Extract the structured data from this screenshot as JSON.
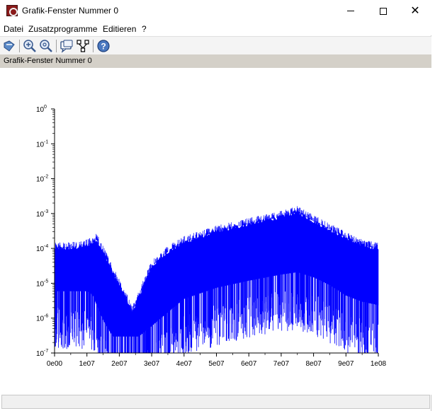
{
  "window": {
    "title": "Grafik-Fenster Nummer 0"
  },
  "menu": {
    "items": [
      "Datei",
      "Zusatzprogramme",
      "Editieren",
      "?"
    ]
  },
  "toolbar": {
    "tools": [
      "rotate-icon",
      "zoom-in-icon",
      "zoom-out-icon",
      "datatip-icon",
      "edit-tree-icon",
      "help-icon"
    ]
  },
  "info_bar": {
    "text": "Grafik-Fenster Nummer 0"
  },
  "colors": {
    "series": "#0000ff",
    "axis": "#000000"
  },
  "chart_data": {
    "type": "area",
    "xlabel": "",
    "ylabel": "",
    "xscale": "linear",
    "yscale": "log",
    "xlim": [
      0,
      100000000
    ],
    "ylim": [
      1e-07,
      1
    ],
    "x_ticks": [
      0,
      10000000,
      20000000,
      30000000,
      40000000,
      50000000,
      60000000,
      70000000,
      80000000,
      90000000,
      100000000
    ],
    "x_tick_labels": [
      "0e00",
      "1e07",
      "2e07",
      "3e07",
      "4e07",
      "5e07",
      "6e07",
      "7e07",
      "8e07",
      "9e07",
      "1e08"
    ],
    "y_ticks": [
      1,
      0.1,
      0.01,
      0.001,
      0.0001,
      1e-05,
      1e-06,
      1e-07
    ],
    "y_tick_bases": [
      "10",
      "10",
      "10",
      "10",
      "10",
      "10",
      "10",
      "10"
    ],
    "y_tick_exponents": [
      "0",
      "-1",
      "-2",
      "-3",
      "-4",
      "-5",
      "-6",
      "-7"
    ],
    "grid": false,
    "legend": "none",
    "series": [
      {
        "x": [
          0,
          5000000,
          10000000,
          12000000,
          13000000,
          15000000,
          18000000,
          22000000,
          24000000,
          26000000,
          30000000,
          35000000,
          40000000,
          50000000,
          60000000,
          70000000,
          75000000,
          80000000,
          85000000,
          90000000,
          95000000,
          100000000
        ],
        "y_upper": [
          0.0001,
          0.0001,
          0.00012,
          0.00015,
          0.00018,
          8e-05,
          2e-05,
          4e-06,
          1.5e-06,
          4e-06,
          3e-05,
          8e-05,
          0.00015,
          0.0003,
          0.0005,
          0.0008,
          0.0011,
          0.0006,
          0.00035,
          0.0002,
          0.00012,
          0.0001
        ],
        "y_lower": [
          2e-06,
          2e-06,
          2e-06,
          1.5e-06,
          8e-07,
          3e-07,
          1e-07,
          1e-07,
          1e-07,
          1e-07,
          2e-07,
          5e-07,
          1.2e-06,
          2.5e-06,
          4e-06,
          6e-06,
          7e-06,
          5e-06,
          3e-06,
          1.5e-06,
          1e-06,
          8e-07
        ]
      }
    ]
  }
}
